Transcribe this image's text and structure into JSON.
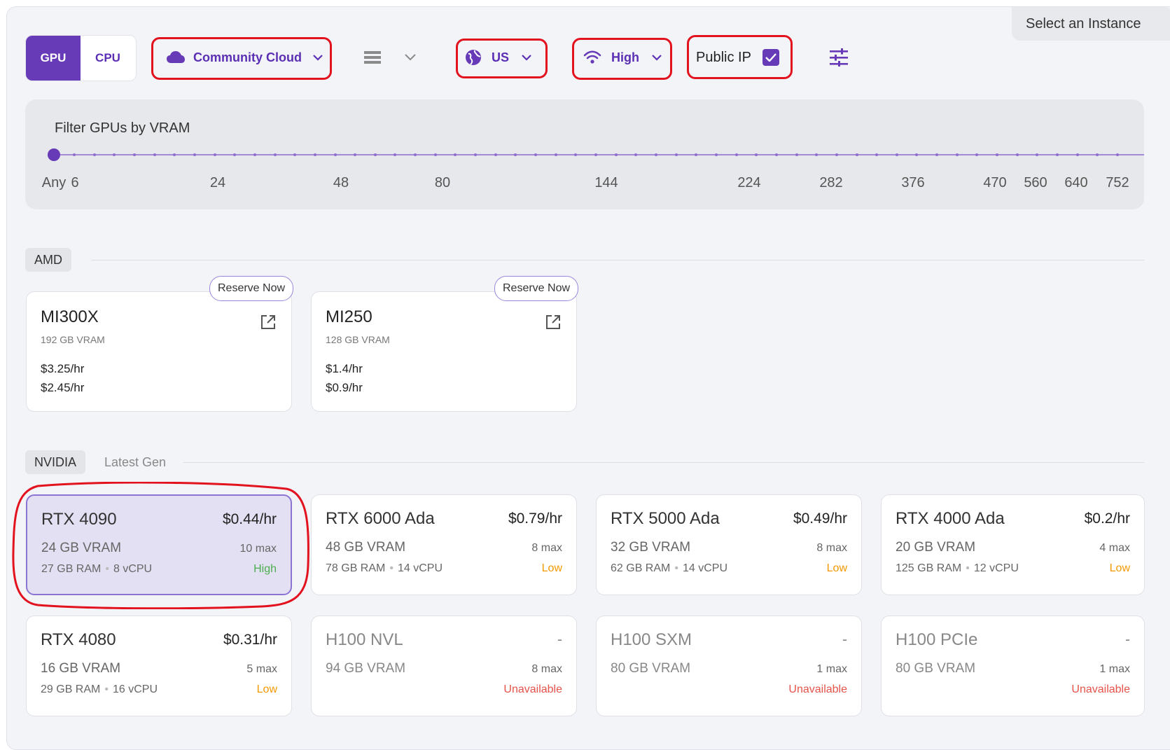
{
  "header": {
    "select_instance": "Select an Instance",
    "gpu_label": "GPU",
    "cpu_label": "CPU",
    "cloud_label": "Community Cloud",
    "region_label": "US",
    "network_label": "High",
    "public_ip_label": "Public IP",
    "public_ip_checked": true
  },
  "vram_filter": {
    "title": "Filter GPUs by VRAM",
    "ticks": [
      "Any",
      "6",
      "24",
      "48",
      "80",
      "144",
      "224",
      "282",
      "376",
      "470",
      "560",
      "640",
      "752"
    ],
    "selected": "Any"
  },
  "amd": {
    "tag": "AMD",
    "cards": [
      {
        "name": "MI300X",
        "vram": "192 GB VRAM",
        "price1": "$3.25/hr",
        "price2": "$2.45/hr",
        "reserve": "Reserve Now"
      },
      {
        "name": "MI250",
        "vram": "128 GB VRAM",
        "price1": "$1.4/hr",
        "price2": "$0.9/hr",
        "reserve": "Reserve Now"
      }
    ]
  },
  "nvidia": {
    "tag": "NVIDIA",
    "tab_latest": "Latest Gen",
    "cards": [
      {
        "name": "RTX 4090",
        "price": "$0.44/hr",
        "vram": "24 GB VRAM",
        "max": "10 max",
        "ram": "27 GB RAM",
        "vcpu": "8 vCPU",
        "availability": "High",
        "selected": true
      },
      {
        "name": "RTX 6000 Ada",
        "price": "$0.79/hr",
        "vram": "48 GB VRAM",
        "max": "8 max",
        "ram": "78 GB RAM",
        "vcpu": "14 vCPU",
        "availability": "Low"
      },
      {
        "name": "RTX 5000 Ada",
        "price": "$0.49/hr",
        "vram": "32 GB VRAM",
        "max": "8 max",
        "ram": "62 GB RAM",
        "vcpu": "14 vCPU",
        "availability": "Low"
      },
      {
        "name": "RTX 4000 Ada",
        "price": "$0.2/hr",
        "vram": "20 GB VRAM",
        "max": "4 max",
        "ram": "125 GB RAM",
        "vcpu": "12 vCPU",
        "availability": "Low"
      },
      {
        "name": "RTX 4080",
        "price": "$0.31/hr",
        "vram": "16 GB VRAM",
        "max": "5 max",
        "ram": "29 GB RAM",
        "vcpu": "16 vCPU",
        "availability": "Low"
      },
      {
        "name": "H100 NVL",
        "price": "-",
        "vram": "94 GB VRAM",
        "max": "8 max",
        "availability": "Unavailable"
      },
      {
        "name": "H100 SXM",
        "price": "-",
        "vram": "80 GB VRAM",
        "max": "1 max",
        "availability": "Unavailable"
      },
      {
        "name": "H100 PCIe",
        "price": "-",
        "vram": "80 GB VRAM",
        "max": "1 max",
        "availability": "Unavailable"
      }
    ]
  },
  "colors": {
    "accent": "#673ab7",
    "high": "#4caf50",
    "low": "#f29900",
    "unavailable": "#e5534b",
    "annotation": "#e3121f"
  }
}
